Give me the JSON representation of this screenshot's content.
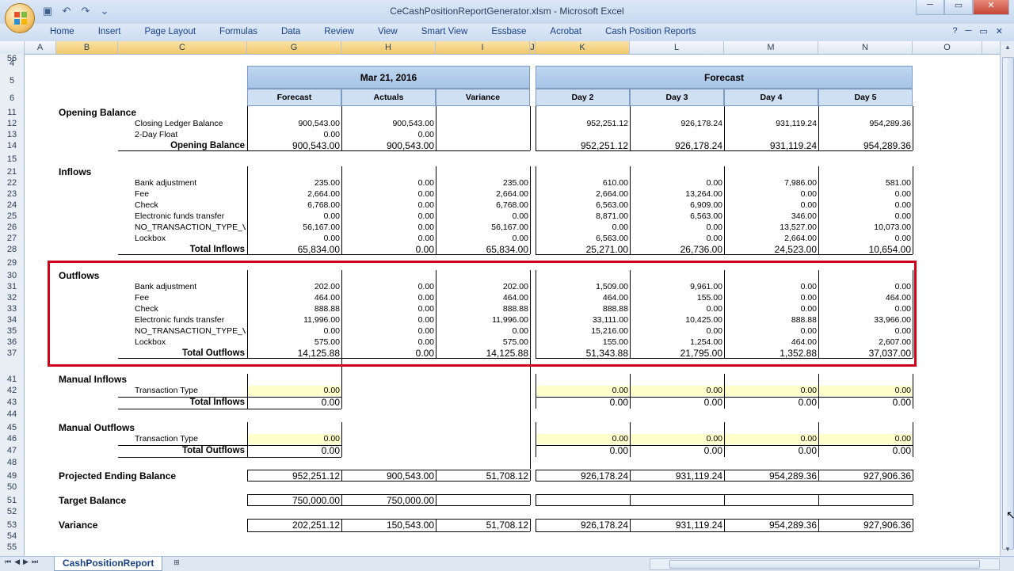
{
  "window": {
    "title": "CeCashPositionReportGenerator.xlsm - Microsoft Excel"
  },
  "ribbon": {
    "tabs": [
      "Home",
      "Insert",
      "Page Layout",
      "Formulas",
      "Data",
      "Review",
      "View",
      "Smart View",
      "Essbase",
      "Acrobat",
      "Cash Position Reports"
    ]
  },
  "columns": [
    "A",
    "B",
    "C",
    "G",
    "H",
    "I",
    "J",
    "K",
    "L",
    "M",
    "N",
    "O"
  ],
  "rows": [
    "4",
    "5",
    "6",
    "11",
    "12",
    "13",
    "14",
    "15",
    "21",
    "22",
    "23",
    "24",
    "25",
    "26",
    "27",
    "28",
    "29",
    "30",
    "31",
    "32",
    "33",
    "34",
    "35",
    "36",
    "37",
    "41",
    "42",
    "43",
    "44",
    "45",
    "46",
    "47",
    "48",
    "49",
    "50",
    "51",
    "52",
    "53",
    "54",
    "55",
    "56"
  ],
  "headers": {
    "date_group": "Mar 21, 2016",
    "forecast_group": "Forecast",
    "sub": [
      "Forecast",
      "Actuals",
      "Variance",
      "Day 2",
      "Day 3",
      "Day 4",
      "Day 5"
    ]
  },
  "sections": {
    "opening": "Opening Balance",
    "inflows": "Inflows",
    "outflows": "Outflows",
    "manual_inflows": "Manual Inflows",
    "manual_outflows": "Manual Outflows",
    "projected": "Projected Ending Balance",
    "target": "Target Balance",
    "variance": "Variance"
  },
  "lines": [
    {
      "label": "Closing Ledger Balance",
      "vals": [
        "900,543.00",
        "900,543.00",
        "",
        "952,251.12",
        "926,178.24",
        "931,119.24",
        "954,289.36"
      ]
    },
    {
      "label": "2-Day Float",
      "vals": [
        "0.00",
        "0.00",
        "",
        "",
        "",
        "",
        ""
      ]
    },
    {
      "label": "Opening Balance",
      "vals": [
        "900,543.00",
        "900,543.00",
        "",
        "952,251.12",
        "926,178.24",
        "931,119.24",
        "954,289.36"
      ]
    },
    {
      "label": "Bank adjustment",
      "vals": [
        "235.00",
        "0.00",
        "235.00",
        "610.00",
        "0.00",
        "7,986.00",
        "581.00"
      ]
    },
    {
      "label": "Fee",
      "vals": [
        "2,664.00",
        "0.00",
        "2,664.00",
        "2,664.00",
        "13,264.00",
        "0.00",
        "0.00"
      ]
    },
    {
      "label": "Check",
      "vals": [
        "6,768.00",
        "0.00",
        "6,768.00",
        "6,563.00",
        "6,909.00",
        "0.00",
        "0.00"
      ]
    },
    {
      "label": "Electronic funds transfer",
      "vals": [
        "0.00",
        "0.00",
        "0.00",
        "8,871.00",
        "6,563.00",
        "346.00",
        "0.00"
      ]
    },
    {
      "label": "NO_TRANSACTION_TYPE_V.",
      "vals": [
        "56,167.00",
        "0.00",
        "56,167.00",
        "0.00",
        "0.00",
        "13,527.00",
        "10,073.00"
      ]
    },
    {
      "label": "Lockbox",
      "vals": [
        "0.00",
        "0.00",
        "0.00",
        "6,563.00",
        "0.00",
        "2,664.00",
        "0.00"
      ]
    },
    {
      "label": "Total Inflows",
      "vals": [
        "65,834.00",
        "0.00",
        "65,834.00",
        "25,271.00",
        "26,736.00",
        "24,523.00",
        "10,654.00"
      ]
    },
    {
      "label": "Bank adjustment",
      "vals": [
        "202.00",
        "0.00",
        "202.00",
        "1,509.00",
        "9,961.00",
        "0.00",
        "0.00"
      ]
    },
    {
      "label": "Fee",
      "vals": [
        "464.00",
        "0.00",
        "464.00",
        "464.00",
        "155.00",
        "0.00",
        "464.00"
      ]
    },
    {
      "label": "Check",
      "vals": [
        "888.88",
        "0.00",
        "888.88",
        "888.88",
        "0.00",
        "0.00",
        "0.00"
      ]
    },
    {
      "label": "Electronic funds transfer",
      "vals": [
        "11,996.00",
        "0.00",
        "11,996.00",
        "33,111.00",
        "10,425.00",
        "888.88",
        "33,966.00"
      ]
    },
    {
      "label": "NO_TRANSACTION_TYPE_V.",
      "vals": [
        "0.00",
        "0.00",
        "0.00",
        "15,216.00",
        "0.00",
        "0.00",
        "0.00"
      ]
    },
    {
      "label": "Lockbox",
      "vals": [
        "575.00",
        "0.00",
        "575.00",
        "155.00",
        "1,254.00",
        "464.00",
        "2,607.00"
      ]
    },
    {
      "label": "Total Outflows",
      "vals": [
        "14,125.88",
        "0.00",
        "14,125.88",
        "51,343.88",
        "21,795.00",
        "1,352.88",
        "37,037.00"
      ]
    },
    {
      "label": "Transaction Type",
      "vals": [
        "0.00",
        "",
        "",
        "0.00",
        "0.00",
        "0.00",
        "0.00"
      ]
    },
    {
      "label": "Total Inflows",
      "vals": [
        "0.00",
        "",
        "",
        "0.00",
        "0.00",
        "0.00",
        "0.00"
      ]
    },
    {
      "label": "Transaction Type",
      "vals": [
        "0.00",
        "",
        "",
        "0.00",
        "0.00",
        "0.00",
        "0.00"
      ]
    },
    {
      "label": "Total Outflows",
      "vals": [
        "0.00",
        "",
        "",
        "0.00",
        "0.00",
        "0.00",
        "0.00"
      ]
    },
    {
      "label": "Projected Ending Balance",
      "vals": [
        "952,251.12",
        "900,543.00",
        "51,708.12",
        "926,178.24",
        "931,119.24",
        "954,289.36",
        "927,906.36"
      ]
    },
    {
      "label": "Target Balance",
      "vals": [
        "750,000.00",
        "750,000.00",
        "",
        "",
        "",
        "",
        ""
      ]
    },
    {
      "label": "Variance",
      "vals": [
        "202,251.12",
        "150,543.00",
        "51,708.12",
        "926,178.24",
        "931,119.24",
        "954,289.36",
        "927,906.36"
      ]
    }
  ],
  "sheet_tab": "CashPositionReport",
  "colors": {
    "highlight": "#d0021b",
    "header": "#a7c4e6",
    "input_fill": "#ffffcc"
  }
}
